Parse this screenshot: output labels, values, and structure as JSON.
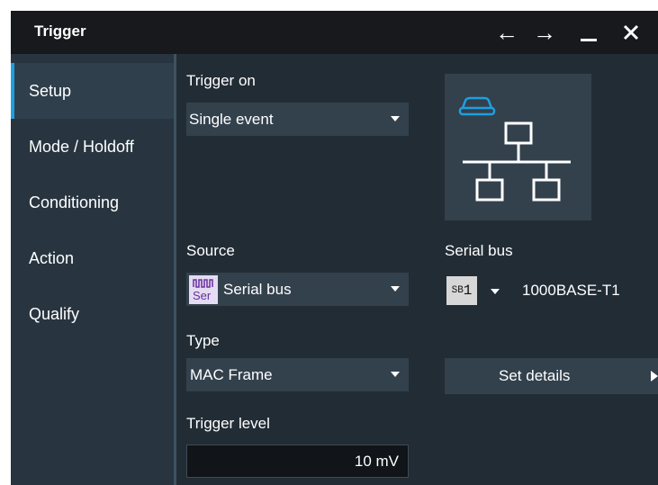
{
  "window": {
    "title": "Trigger",
    "icons": [
      "arrow-left-icon",
      "arrow-right-icon",
      "minimize-icon",
      "close-icon"
    ]
  },
  "sidebar": {
    "items": [
      {
        "label": "Setup",
        "active": true
      },
      {
        "label": "Mode / Holdoff",
        "active": false
      },
      {
        "label": "Conditioning",
        "active": false
      },
      {
        "label": "Action",
        "active": false
      },
      {
        "label": "Qualify",
        "active": false
      }
    ]
  },
  "trigger_on": {
    "label": "Trigger on",
    "value": "Single event"
  },
  "source": {
    "label": "Source",
    "value": "Serial bus",
    "icon_text": [
      "Ser"
    ],
    "icon": "serial-bus-icon"
  },
  "serial_bus": {
    "label": "Serial bus",
    "badge_prefix": "SB",
    "badge_number": "1",
    "protocol": "1000BASE-T1"
  },
  "type": {
    "label": "Type",
    "value": "MAC Frame"
  },
  "set_details": {
    "label": "Set details"
  },
  "trigger_level": {
    "label": "Trigger level",
    "value": "10 mV"
  },
  "colors": {
    "accent": "#1e9fe0",
    "background": "#222c35",
    "titlebar": "#17191c",
    "sidebar": "#283540",
    "control": "#33414d"
  }
}
